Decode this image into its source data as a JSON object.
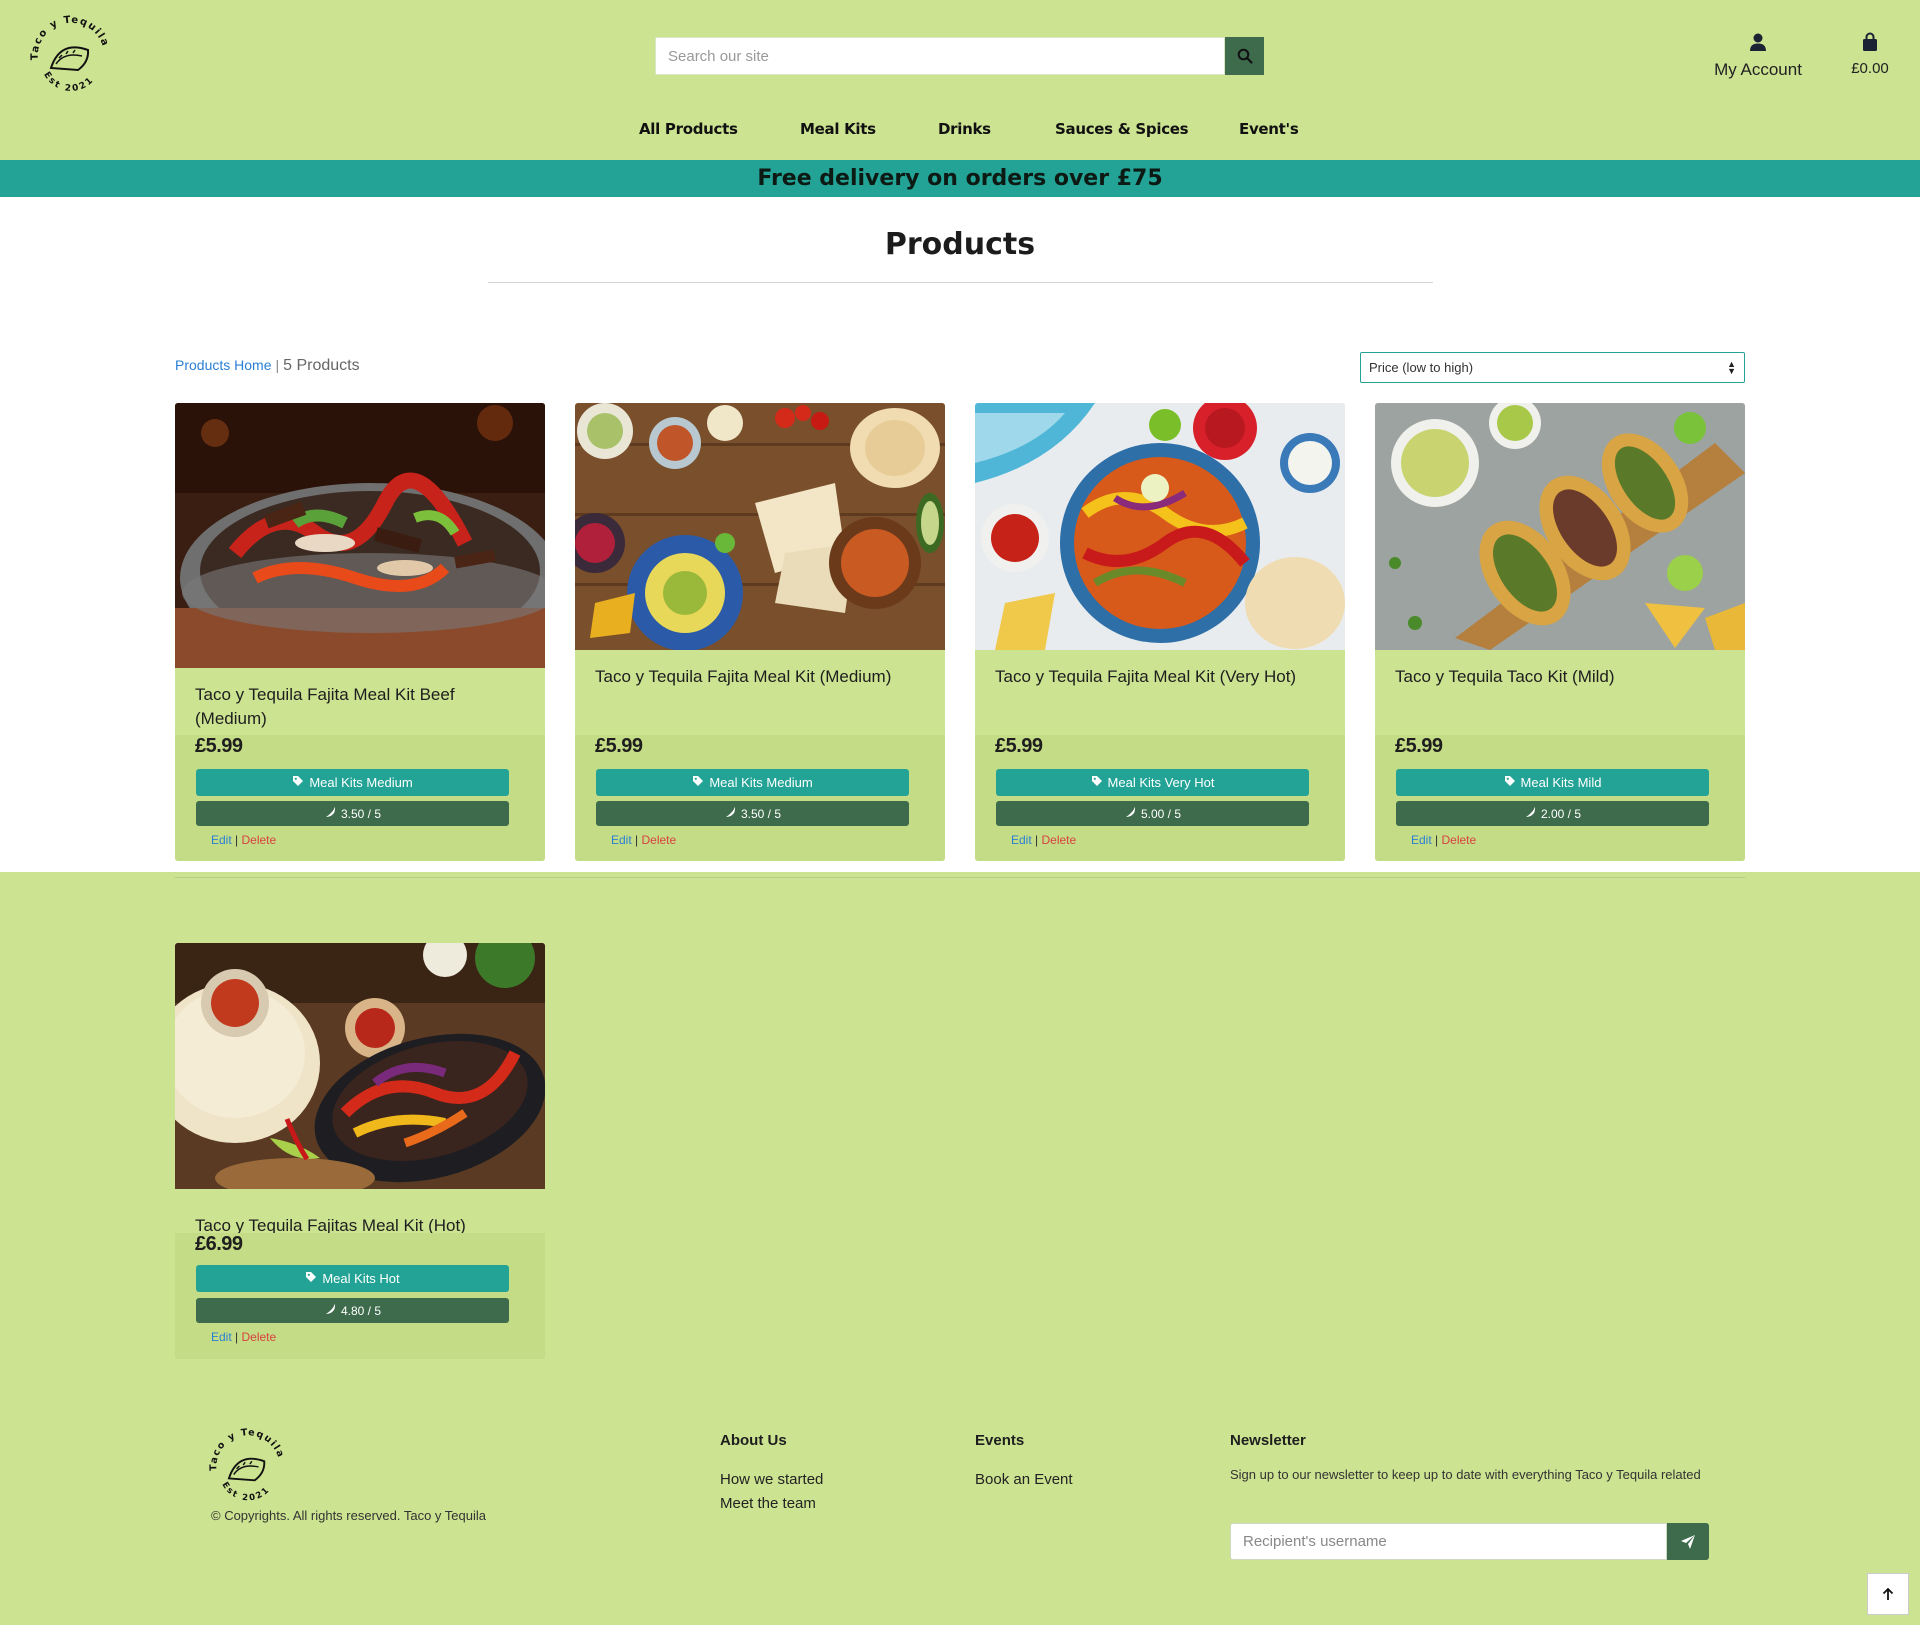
{
  "header": {
    "search_placeholder": "Search our site",
    "account_label": "My Account",
    "cart_total": "£0.00"
  },
  "nav": [
    "All Products",
    "Meal Kits",
    "Drinks",
    "Sauces & Spices",
    "Event's"
  ],
  "banner": "Free delivery on orders over £75",
  "page": {
    "title": "Products",
    "breadcrumb_home": "Products Home",
    "breadcrumb_sep": "|",
    "product_count": "5 Products",
    "sort_value": "Price (low to high)"
  },
  "products": [
    {
      "name": "Taco y Tequila Fajita Meal Kit Beef (Medium)",
      "price": "£5.99",
      "category": "Meal Kits Medium",
      "rating": "3.50 / 5",
      "image": "beef-fajita-skillet"
    },
    {
      "name": "Taco y Tequila Fajita Meal Kit (Medium)",
      "price": "£5.99",
      "category": "Meal Kits Medium",
      "rating": "3.50 / 5",
      "image": "fajita-spread-table"
    },
    {
      "name": "Taco y Tequila Fajita Meal Kit (Very Hot)",
      "price": "£5.99",
      "category": "Meal Kits Very Hot",
      "rating": "5.00 / 5",
      "image": "fajita-pan-very-hot"
    },
    {
      "name": "Taco y Tequila Taco Kit (Mild)",
      "price": "£5.99",
      "category": "Meal Kits Mild",
      "rating": "2.00 / 5",
      "image": "tacos-on-board"
    },
    {
      "name": "Taco y Tequila Fajitas Meal Kit (Hot)",
      "price": "£6.99",
      "category": "Meal Kits Hot",
      "rating": "4.80 / 5",
      "image": "fajitas-hot-skillet"
    }
  ],
  "admin": {
    "edit": "Edit",
    "sep": "|",
    "delete": "Delete"
  },
  "footer": {
    "logo_text_top": "Taco y Tequila",
    "logo_text_bottom": "Est 2021",
    "copyright": "© Copyrights. All rights reserved. Taco y Tequila",
    "about_title": "About Us",
    "about_links": [
      "How we started",
      "Meet the team"
    ],
    "events_title": "Events",
    "events_links": [
      "Book an Event"
    ],
    "newsletter_title": "Newsletter",
    "newsletter_text": "Sign up to our newsletter to keep up to date with everything Taco y Tequila related",
    "newsletter_placeholder": "Recipient's username"
  },
  "colors": {
    "page_bg": "#cce391",
    "accent_teal": "#22a396",
    "accent_green": "#3d6b4c",
    "link_blue": "#2a7fd4",
    "delete_red": "#d84040"
  },
  "icons": [
    "taco-logo",
    "search-icon",
    "user-icon",
    "shopping-bag-icon",
    "tag-icon",
    "chili-pepper-icon",
    "paper-plane-icon",
    "arrow-up-icon",
    "sort-arrows-icon"
  ]
}
